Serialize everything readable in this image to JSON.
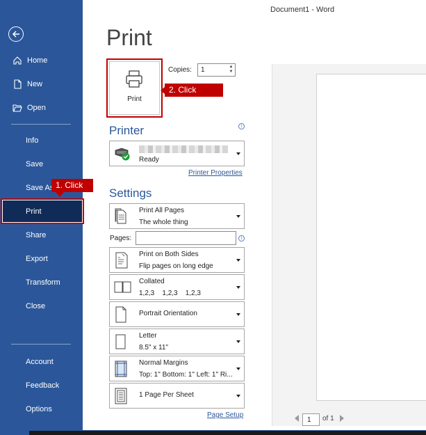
{
  "window": {
    "title": "Document1  -  Word"
  },
  "sidebar": {
    "items": [
      {
        "label": "Home"
      },
      {
        "label": "New"
      },
      {
        "label": "Open"
      },
      {
        "label": "Info"
      },
      {
        "label": "Save"
      },
      {
        "label": "Save As"
      },
      {
        "label": "Print"
      },
      {
        "label": "Share"
      },
      {
        "label": "Export"
      },
      {
        "label": "Transform"
      },
      {
        "label": "Close"
      },
      {
        "label": "Account"
      },
      {
        "label": "Feedback"
      },
      {
        "label": "Options"
      }
    ]
  },
  "page": {
    "heading": "Print"
  },
  "print_button": {
    "label": "Print"
  },
  "copies": {
    "label": "Copies:",
    "value": "1"
  },
  "callouts": {
    "step1": "1. Click",
    "step2": "2. Click"
  },
  "printer": {
    "section_title": "Printer",
    "status": "Ready",
    "properties_link": "Printer Properties"
  },
  "settings": {
    "section_title": "Settings",
    "pages_label": "Pages:",
    "pages_value": "",
    "dropdowns": [
      {
        "line1": "Print All Pages",
        "line2": "The whole thing",
        "icon": "pages-icon"
      },
      {
        "line1": "Print on Both Sides",
        "line2": "Flip pages on long edge",
        "icon": "duplex-icon"
      },
      {
        "line1": "Collated",
        "line2": "1,2,3    1,2,3    1,2,3",
        "icon": "collated-icon"
      },
      {
        "line1": "Portrait Orientation",
        "line2": "",
        "icon": "portrait-icon"
      },
      {
        "line1": "Letter",
        "line2": "8.5\" x 11\"",
        "icon": "paper-icon"
      },
      {
        "line1": "Normal Margins",
        "line2": "Top: 1\" Bottom: 1\" Left: 1\" Ri...",
        "icon": "margins-icon"
      },
      {
        "line1": "1 Page Per Sheet",
        "line2": "",
        "icon": "pages-per-sheet-icon"
      }
    ],
    "page_setup_link": "Page Setup"
  },
  "preview": {
    "current_page": "1",
    "of_label": "of 1"
  },
  "colors": {
    "brand": "#2b579a",
    "callout": "#c00000",
    "active_nav": "#102b57"
  }
}
